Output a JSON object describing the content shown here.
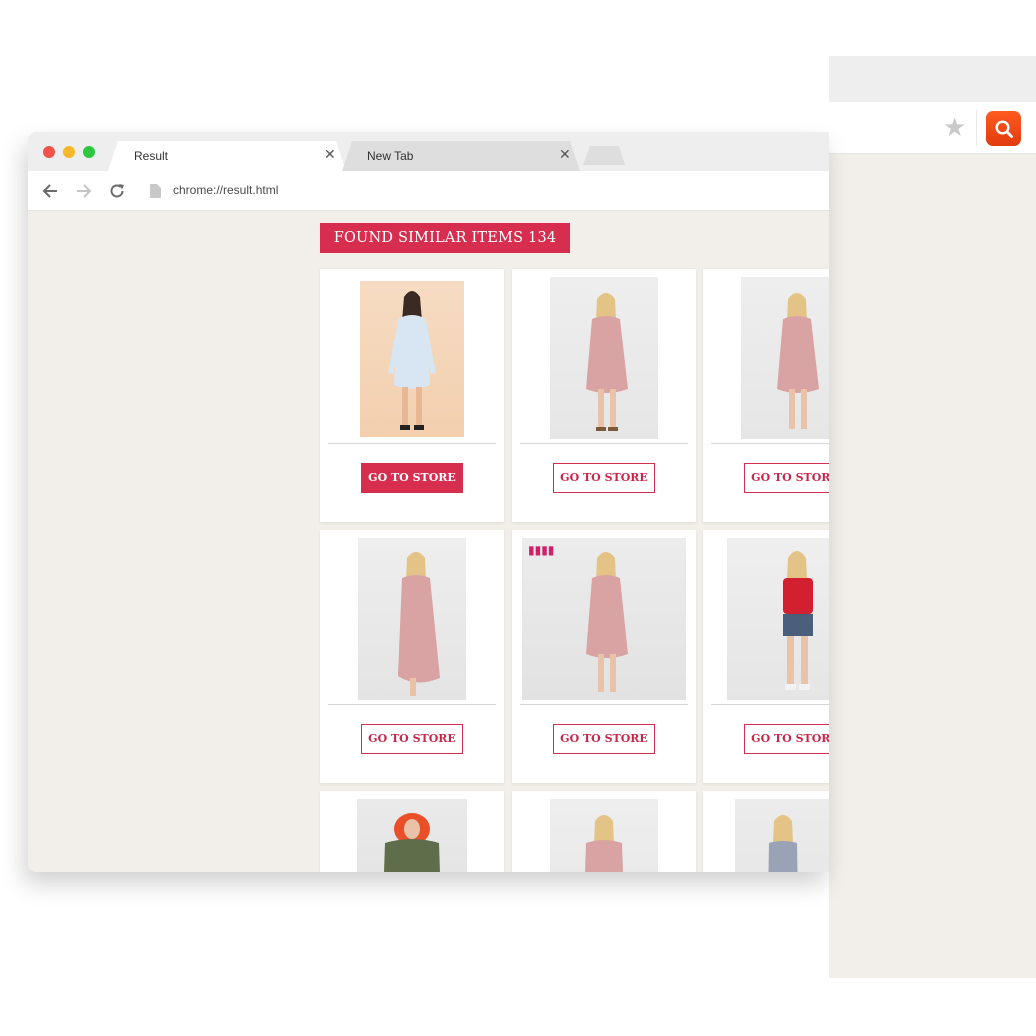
{
  "browser": {
    "tabs": [
      {
        "label": "Result",
        "active": true
      },
      {
        "label": "New Tab",
        "active": false
      }
    ],
    "address_bar": {
      "url": "chrome://result.html"
    },
    "icons": {
      "back": "arrow-left-icon",
      "forward": "arrow-right-icon",
      "reload": "reload-icon",
      "page": "page-icon",
      "tab_close": "close-icon",
      "bookmark": "star-icon",
      "extension": "search-icon"
    }
  },
  "results": {
    "banner": "FOUND SIMILAR ITEMS 134",
    "button_label": "GO TO STORE",
    "items": [
      {
        "image": "woman in light blue dress",
        "button": "GO TO STORE",
        "primary": true
      },
      {
        "image": "woman in pink dress",
        "button": "GO TO STORE",
        "primary": false
      },
      {
        "image": "woman in pink dress",
        "button": "GO TO STORE",
        "primary": false
      },
      {
        "image": "woman in pink dress",
        "button": "GO TO STORE",
        "primary": false
      },
      {
        "image": "woman in pink dress",
        "button": "GO TO STORE",
        "primary": false
      },
      {
        "image": "woman in red t-shirt and denim shorts",
        "button": "GO TO STORE",
        "primary": false
      },
      {
        "image": "woman in green parka with orange fur hood",
        "button": "",
        "primary": false
      },
      {
        "image": "woman in pink top",
        "button": "",
        "primary": false
      },
      {
        "image": "woman in grey cami top",
        "button": "",
        "primary": false
      }
    ]
  },
  "colors": {
    "accent": "#d72e4f",
    "page_background": "#f2eeea",
    "extension_button": "#e8420f"
  }
}
